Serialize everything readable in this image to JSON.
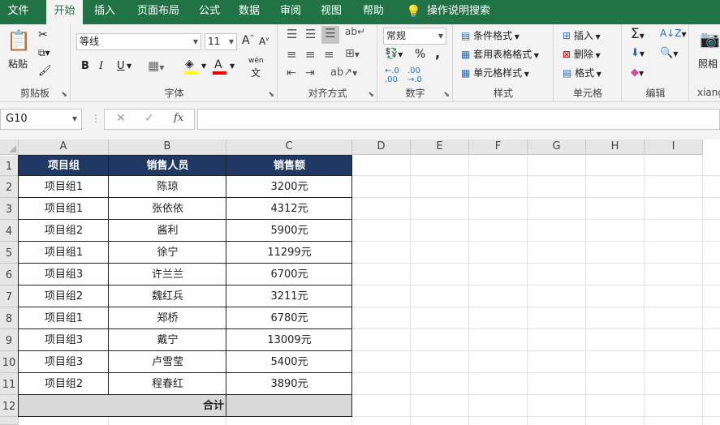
{
  "menu": {
    "tabs": [
      "文件",
      "开始",
      "插入",
      "页面布局",
      "公式",
      "数据",
      "审阅",
      "视图",
      "帮助"
    ],
    "active": "开始",
    "tell_me": "操作说明搜索"
  },
  "ribbon": {
    "clipboard": {
      "label": "剪贴板",
      "paste": "粘贴"
    },
    "font": {
      "label": "字体",
      "name": "等线",
      "size": "11",
      "grow": "A",
      "shrink": "A",
      "bold": "B",
      "italic": "I",
      "underline": "U",
      "phonetic": "wén"
    },
    "alignment": {
      "label": "对齐方式"
    },
    "number": {
      "label": "数字",
      "format": "常规",
      "percent": "%",
      "comma": ","
    },
    "styles": {
      "label": "样式",
      "conditional": "条件格式",
      "table": "套用表格格式",
      "cell": "单元格样式"
    },
    "cells": {
      "label": "单元格",
      "insert": "插入",
      "delete": "删除",
      "format": "格式"
    },
    "editing": {
      "label": "编辑"
    },
    "extra": {
      "camera": "照相",
      "label": "xiang"
    }
  },
  "formula_bar": {
    "name_box": "G10",
    "cancel": "✕",
    "enter": "✓",
    "fx": "fx",
    "formula": ""
  },
  "sheet": {
    "columns": [
      "A",
      "B",
      "C",
      "D",
      "E",
      "F",
      "G",
      "H",
      "I"
    ],
    "rows": [
      "1",
      "2",
      "3",
      "4",
      "5",
      "6",
      "7",
      "8",
      "9",
      "10",
      "11",
      "12"
    ],
    "headers": [
      "项目组",
      "销售人员",
      "销售额"
    ],
    "data": [
      [
        "项目组1",
        "陈琼",
        "3200元"
      ],
      [
        "项目组1",
        "张依依",
        "4312元"
      ],
      [
        "项目组2",
        "酱利",
        "5900元"
      ],
      [
        "项目组1",
        "徐宁",
        "11299元"
      ],
      [
        "项目组3",
        "许兰兰",
        "6700元"
      ],
      [
        "项目组2",
        "魏红兵",
        "3211元"
      ],
      [
        "项目组1",
        "郑桥",
        "6780元"
      ],
      [
        "项目组3",
        "戴宁",
        "13009元"
      ],
      [
        "项目组3",
        "卢雪莹",
        "5400元"
      ],
      [
        "项目组2",
        "程春红",
        "3890元"
      ]
    ],
    "total_label": "合计",
    "total_value": ""
  },
  "colors": {
    "accent": "#217346",
    "header_fill": "#203864",
    "total_fill": "#d9d9d9"
  }
}
